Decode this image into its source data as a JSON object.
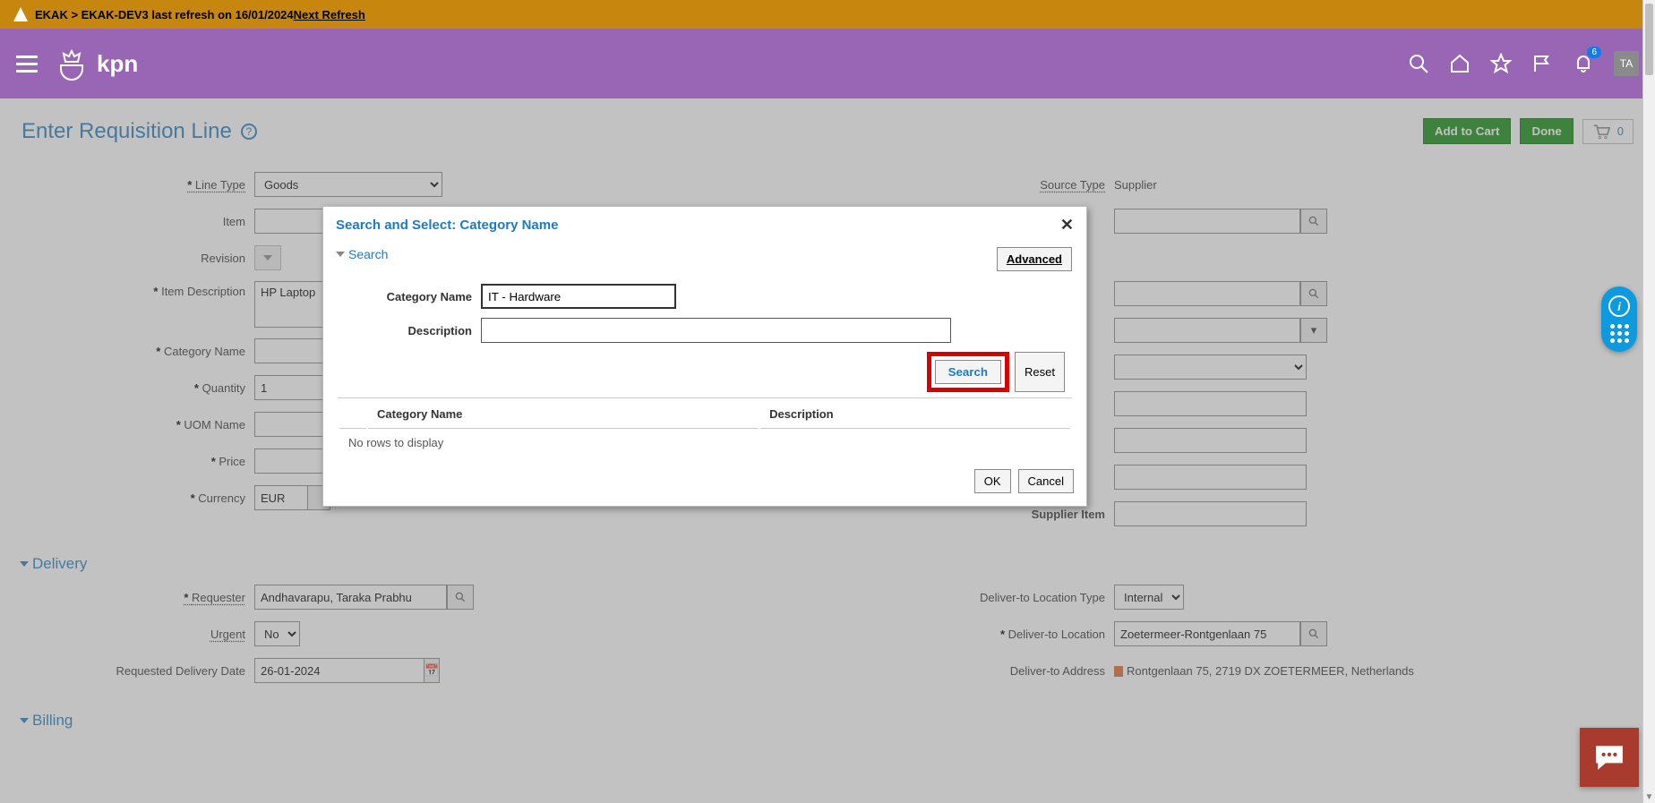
{
  "warn_bar": {
    "text_prefix": "EKAK > EKAK-DEV3 last refresh on 16/01/2024 ",
    "link": "Next Refresh"
  },
  "header": {
    "logo_text": "kpn",
    "notif_count": "6",
    "avatar": "TA"
  },
  "page": {
    "title": "Enter Requisition Line",
    "add_to_cart": "Add to Cart",
    "done": "Done",
    "cart_count": "0"
  },
  "left_fields": {
    "line_type_label": "Line Type",
    "line_type_value": "Goods",
    "item_label": "Item",
    "item_value": "",
    "revision_label": "Revision",
    "item_desc_label": "Item Description",
    "item_desc_value": "HP Laptop",
    "category_label": "Category Name",
    "category_value": "",
    "quantity_label": "Quantity",
    "quantity_value": "1",
    "uom_label": "UOM Name",
    "uom_value": "",
    "price_label": "Price",
    "price_value": "",
    "currency_label": "Currency",
    "currency_value": "EUR"
  },
  "right_fields": {
    "source_type_label": "Source Type",
    "source_type_value": "Supplier",
    "supplier_item_label": "Supplier Item",
    "supplier_item_value": ""
  },
  "delivery": {
    "section": "Delivery",
    "requester_label": "Requester",
    "requester_value": "Andhavarapu, Taraka Prabhu",
    "urgent_label": "Urgent",
    "urgent_value": "No",
    "req_date_label": "Requested Delivery Date",
    "req_date_value": "26-01-2024",
    "deliver_type_label": "Deliver-to Location Type",
    "deliver_type_value": "Internal",
    "deliver_loc_label": "Deliver-to Location",
    "deliver_loc_value": "Zoetermeer-Rontgenlaan 75",
    "deliver_addr_label": "Deliver-to Address",
    "deliver_addr_value": "Rontgenlaan 75, 2719 DX ZOETERMEER, Netherlands"
  },
  "billing": {
    "section": "Billing"
  },
  "modal": {
    "title": "Search and Select: Category Name",
    "search_link": "Search",
    "advanced": "Advanced",
    "cat_label": "Category Name",
    "cat_value": "IT - Hardware",
    "desc_label": "Description",
    "desc_value": "",
    "search_btn": "Search",
    "reset_btn": "Reset",
    "col_cat": "Category Name",
    "col_desc": "Description",
    "no_rows": "No rows to display",
    "ok": "OK",
    "cancel": "Cancel"
  }
}
